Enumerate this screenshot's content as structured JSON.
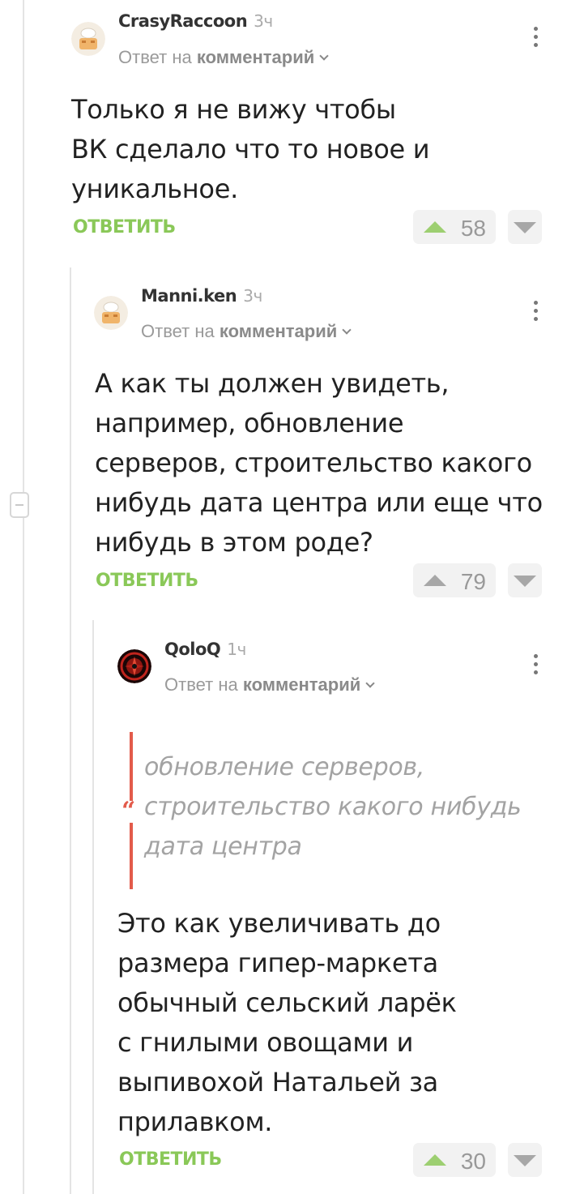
{
  "reply_to_prefix": "Ответ на",
  "reply_to_target": "комментарий",
  "reply_label": "ОТВЕТИТЬ",
  "comments": [
    {
      "author": "CrasyRaccoon",
      "age": "3ч",
      "avatar_icon": "raccoon-chef-avatar",
      "lines": [
        "Только я не вижу чтобы",
        "ВК сделало что то новое и",
        "уникальное."
      ],
      "votes": "58",
      "upvoted": true
    },
    {
      "author": "Manni.ken",
      "age": "3ч",
      "avatar_icon": "chef-avatar",
      "lines": [
        "А как ты должен увидеть,",
        "например, обновление",
        "серверов, строительство какого",
        "нибудь дата центра или еще что",
        "нибудь в этом роде?"
      ],
      "votes": "79",
      "upvoted": false
    },
    {
      "author": "QoloQ",
      "age": "1ч",
      "avatar_icon": "red-emblem-avatar",
      "quote_lines": [
        "обновление серверов,",
        "строительство какого нибудь",
        "дата центра"
      ],
      "lines": [
        "Это как увеличивать до",
        "размера гипер-маркета",
        "обычный сельский ларёк",
        "с гнилыми овощами и",
        "выпивохой Натальей за",
        "прилавком."
      ],
      "votes": "30",
      "upvoted": true
    }
  ],
  "colors": {
    "accent_green": "#8ac858",
    "upvote_green": "#9dcf71",
    "quote_red": "#e35b4b",
    "muted_text": "#9a9a9a"
  }
}
